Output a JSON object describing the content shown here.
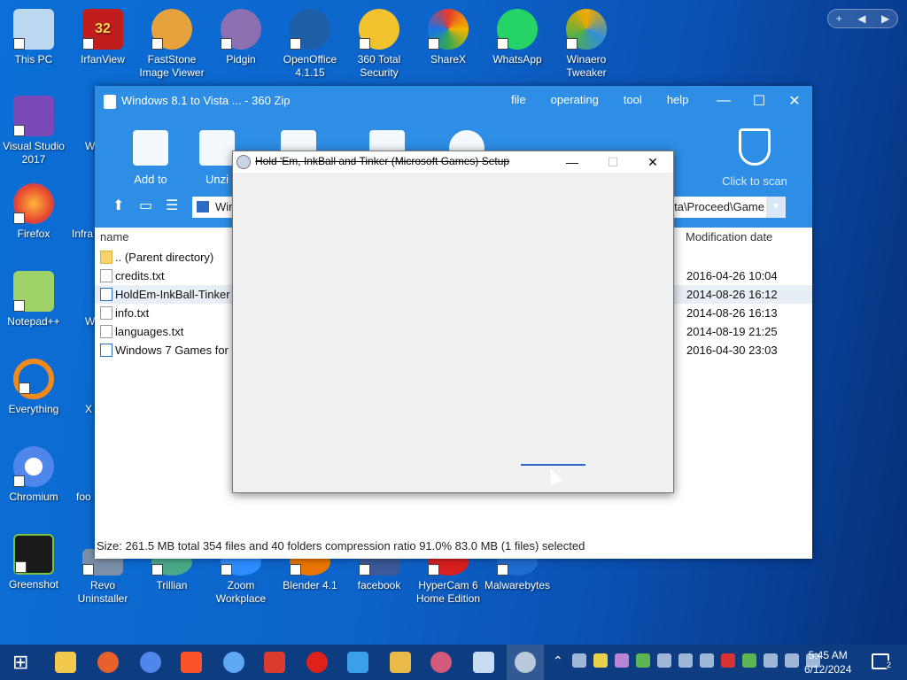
{
  "desktop_icons": [
    {
      "label": "This PC"
    },
    {
      "label": "IrfanView"
    },
    {
      "label": "FastStone Image Viewer"
    },
    {
      "label": "Pidgin"
    },
    {
      "label": "OpenOffice 4.1.15"
    },
    {
      "label": "360 Total Security"
    },
    {
      "label": "ShareX"
    },
    {
      "label": "WhatsApp"
    },
    {
      "label": "Winaero Tweaker"
    },
    {
      "label": "Visual Studio 2017"
    },
    {
      "label": "Firefox"
    },
    {
      "label": "Notepad++"
    },
    {
      "label": "Everything"
    },
    {
      "label": "Chromium"
    },
    {
      "label": "Greenshot"
    },
    {
      "label": "Revo Uninstaller"
    },
    {
      "label": "Trillian"
    },
    {
      "label": "Zoom Workplace"
    },
    {
      "label": "Blender 4.1"
    },
    {
      "label": "facebook"
    },
    {
      "label": "HyperCam 6 Home Edition"
    },
    {
      "label": "Malwarebytes"
    },
    {
      "label": "W"
    },
    {
      "label": "Infra"
    },
    {
      "label": "W"
    },
    {
      "label": "X"
    },
    {
      "label": "foo"
    }
  ],
  "irfanview_badge": "32",
  "zip_window": {
    "title": "Windows 8.1 to Vista ... - 360 Zip",
    "menu": [
      "file",
      "operating",
      "tool",
      "help"
    ],
    "toolbar": [
      "Add to",
      "Unzi"
    ],
    "scan_label": "Click to scan",
    "address_left": "Wir",
    "address_right": "ista\\Proceed\\Game",
    "columns": {
      "name": "name",
      "date": "Modification date"
    },
    "files": [
      {
        "name": ".. (Parent directory)",
        "date": ""
      },
      {
        "name": "credits.txt",
        "date": "2016-04-26 10:04"
      },
      {
        "name": "HoldEm-InkBall-Tinker",
        "date": "2014-08-26 16:12"
      },
      {
        "name": "info.txt",
        "date": "2014-08-26 16:13"
      },
      {
        "name": "languages.txt",
        "date": "2014-08-19 21:25"
      },
      {
        "name": "Windows 7 Games for",
        "date": "2016-04-30 23:03"
      }
    ],
    "status": "Size: 261.5 MB total 354 files and 40 folders compression ratio 91.0% 83.0 MB (1 files) selected"
  },
  "setup_dialog": {
    "title": "Hold 'Em, InkBall and Tinker (Microsoft Games) Setup"
  },
  "taskbar": {
    "time": "5:45 AM",
    "date": "6/12/2024",
    "notification_count": "2"
  }
}
